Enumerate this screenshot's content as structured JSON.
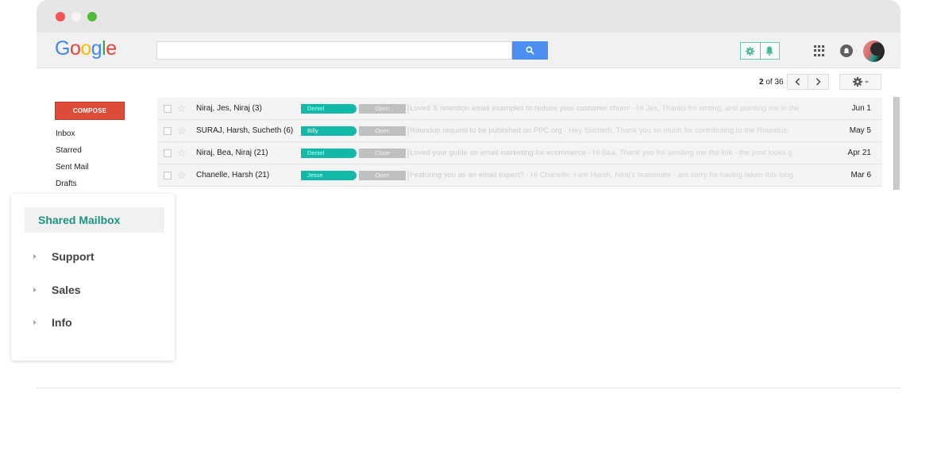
{
  "window": {
    "controls": [
      "close",
      "minimize",
      "maximize"
    ]
  },
  "header": {
    "logo": [
      "G",
      "o",
      "o",
      "g",
      "l",
      "e"
    ],
    "logo_colors": [
      "#4285f4",
      "#ea4335",
      "#fbbc05",
      "#4285f4",
      "#34a853",
      "#ea4335"
    ],
    "search": {
      "value": "",
      "placeholder": ""
    },
    "search_icon": "search-icon",
    "extension_icons": [
      "gear-icon",
      "bell-icon"
    ],
    "apps_icon": "apps-grid-icon",
    "notifications_icon": "notifications-icon",
    "avatar": "user-avatar"
  },
  "toolbar": {
    "pager_current": "2",
    "pager_sep": " of ",
    "pager_total": "36",
    "prev": "‹",
    "next": "›"
  },
  "sidebar": {
    "compose_label": "COMPOSE",
    "items": [
      {
        "label": "Inbox"
      },
      {
        "label": "Starred"
      },
      {
        "label": "Sent Mail"
      },
      {
        "label": "Drafts"
      }
    ]
  },
  "emails": [
    {
      "sender": "Niraj, Jes, Niraj (3)",
      "assignee": "Deniel",
      "status": "Open",
      "subject": "Loved '6 retention email examples to reduce your customer churn'",
      "preview": " - Hi Jes, Thanks for writing, and pointing me in the",
      "date": "Jun 1"
    },
    {
      "sender": "SURAJ, Harsh, Sucheth (6)",
      "assignee": "Billy",
      "status": "Open",
      "subject": "Roundup request to be published on PPC.org",
      "preview": " - Hey Sucheth, Thank you so much for contributing to the Roundup:",
      "date": "May 5"
    },
    {
      "sender": "Niraj, Bea, Niraj (21)",
      "assignee": "Deniel",
      "status": "Close",
      "subject": "Loved your guide on email marketing for ecommerce",
      "preview": " - Hi Bea, Thank you for sending me the link - the post looks g",
      "date": "Apr 21"
    },
    {
      "sender": "Chanelle, Harsh (21)",
      "assignee": "Jesse",
      "status": "Open",
      "subject": "Featuring you as an email expert?",
      "preview": " - Hi Chanelle, I am Harsh, Niraj's teammate - am sorry for having taken this long",
      "date": "Mar 6"
    }
  ],
  "shared_mailbox": {
    "title": "Shared Mailbox",
    "folders": [
      {
        "label": "Support"
      },
      {
        "label": "Sales"
      },
      {
        "label": "Info"
      }
    ]
  },
  "colors": {
    "accent_teal": "#13b9a8",
    "compose_red": "#dd4b39",
    "search_blue": "#4d8ff0",
    "mailbox_title": "#1c9383"
  }
}
